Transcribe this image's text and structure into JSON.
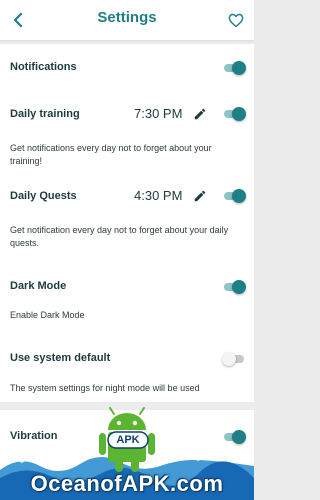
{
  "header": {
    "title": "Settings"
  },
  "colors": {
    "accent": "#1f7f86",
    "toggle_track_on": "#8cc4c8",
    "toggle_off": "#c8c8c8",
    "background": "#ececec"
  },
  "settings": {
    "notifications": {
      "label": "Notifications",
      "enabled": true
    },
    "daily_training": {
      "label": "Daily training",
      "time": "7:30 PM",
      "enabled": true,
      "description": "Get notifications every day not to forget about your training!"
    },
    "daily_quests": {
      "label": "Daily Quests",
      "time": "4:30 PM",
      "enabled": true,
      "description": "Get notification every day not to forget about your daily quests."
    },
    "dark_mode": {
      "label": "Dark Mode",
      "enabled": true,
      "description": "Enable Dark Mode"
    },
    "use_system_default": {
      "label": "Use system default",
      "enabled": false,
      "description": "The system settings for night mode will be used"
    },
    "vibration": {
      "label": "Vibration",
      "enabled": true
    }
  },
  "watermark": {
    "text": "OceanofAPK.com",
    "badge": "APK"
  }
}
